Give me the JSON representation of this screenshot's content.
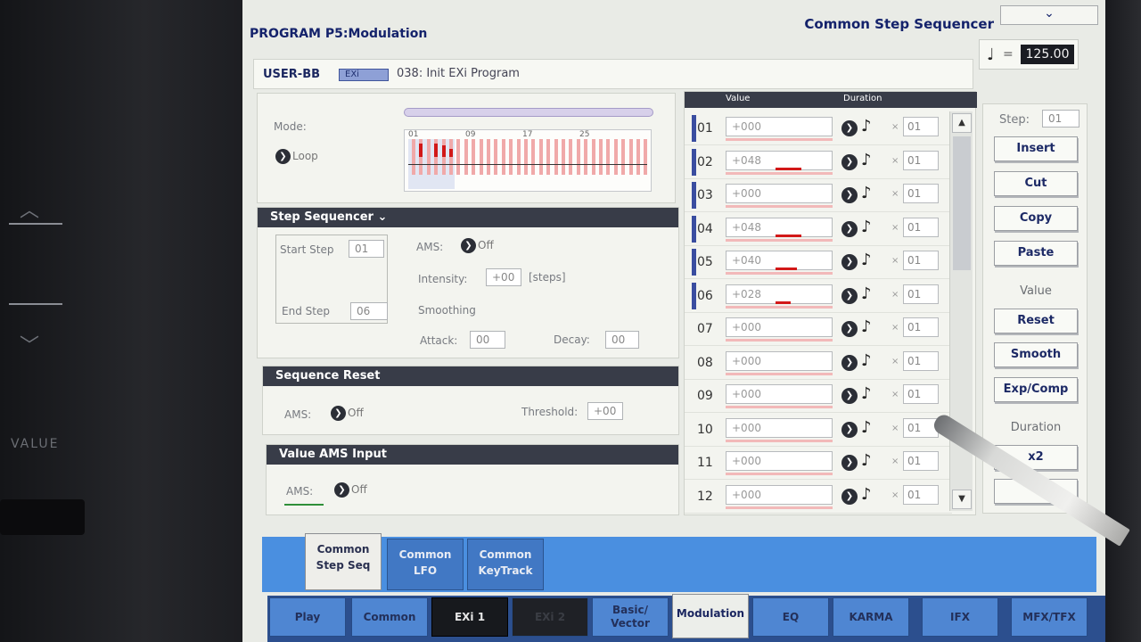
{
  "bezel": {
    "value_label": "VALUE"
  },
  "window": {
    "title": "PROGRAM P5:Modulation",
    "page_menu": "Common Step Sequencer",
    "menu_button": "⌄",
    "tempo_note": "♩",
    "tempo_eq": "=",
    "tempo": "125.00"
  },
  "program": {
    "bank": "USER-BB",
    "type_badge": "EXi",
    "name": "038: Init EXi Program"
  },
  "mode_panel": {
    "mode_label": "Mode:",
    "mode_value": "Loop",
    "graph_ticks": [
      "01",
      "09",
      "17",
      "25"
    ]
  },
  "step_sequencer": {
    "title": "Step Sequencer",
    "start_step_label": "Start Step",
    "start_step": "01",
    "end_step_label": "End Step",
    "end_step": "06",
    "ams_label": "AMS:",
    "ams_value": "Off",
    "intensity_label": "Intensity:",
    "intensity": "+00",
    "intensity_unit": "[steps]",
    "smoothing_label": "Smoothing",
    "attack_label": "Attack:",
    "attack": "00",
    "decay_label": "Decay:",
    "decay": "00"
  },
  "sequence_reset": {
    "title": "Sequence Reset",
    "ams_label": "AMS:",
    "ams_value": "Off",
    "threshold_label": "Threshold:",
    "threshold": "+00"
  },
  "value_ams": {
    "title": "Value AMS Input",
    "ams_label": "AMS:",
    "ams_value": "Off"
  },
  "step_table": {
    "value_header": "Value",
    "duration_header": "Duration",
    "rows": [
      {
        "step": "01",
        "value": "+000",
        "dur": "01",
        "level": 0,
        "active": true
      },
      {
        "step": "02",
        "value": "+048",
        "dur": "01",
        "level": 48,
        "active": true
      },
      {
        "step": "03",
        "value": "+000",
        "dur": "01",
        "level": 0,
        "active": true
      },
      {
        "step": "04",
        "value": "+048",
        "dur": "01",
        "level": 48,
        "active": true
      },
      {
        "step": "05",
        "value": "+040",
        "dur": "01",
        "level": 40,
        "active": true
      },
      {
        "step": "06",
        "value": "+028",
        "dur": "01",
        "level": 28,
        "active": true
      },
      {
        "step": "07",
        "value": "+000",
        "dur": "01",
        "level": 0,
        "active": false
      },
      {
        "step": "08",
        "value": "+000",
        "dur": "01",
        "level": 0,
        "active": false
      },
      {
        "step": "09",
        "value": "+000",
        "dur": "01",
        "level": 0,
        "active": false
      },
      {
        "step": "10",
        "value": "+000",
        "dur": "01",
        "level": 0,
        "active": false
      },
      {
        "step": "11",
        "value": "+000",
        "dur": "01",
        "level": 0,
        "active": false
      },
      {
        "step": "12",
        "value": "+000",
        "dur": "01",
        "level": 0,
        "active": false
      }
    ]
  },
  "side": {
    "step_label": "Step:",
    "step": "01",
    "insert": "Insert",
    "cut": "Cut",
    "copy": "Copy",
    "paste": "Paste",
    "value_section": "Value",
    "reset": "Reset",
    "smooth": "Smooth",
    "expcomp": "Exp/Comp",
    "duration_section": "Duration",
    "x2": "x2"
  },
  "subtabs": [
    {
      "l1": "Common",
      "l2": "Step Seq"
    },
    {
      "l1": "Common",
      "l2": "LFO"
    },
    {
      "l1": "Common",
      "l2": "KeyTrack"
    }
  ],
  "tabs": [
    {
      "l1": "Play",
      "l2": ""
    },
    {
      "l1": "Common",
      "l2": ""
    },
    {
      "l1": "EXi 1",
      "l2": ""
    },
    {
      "l1": "EXi 2",
      "l2": ""
    },
    {
      "l1": "Basic/",
      "l2": "Vector"
    },
    {
      "l1": "Modulation",
      "l2": ""
    },
    {
      "l1": "EQ",
      "l2": ""
    },
    {
      "l1": "KARMA",
      "l2": ""
    },
    {
      "l1": "IFX",
      "l2": ""
    },
    {
      "l1": "MFX/TFX",
      "l2": ""
    }
  ]
}
